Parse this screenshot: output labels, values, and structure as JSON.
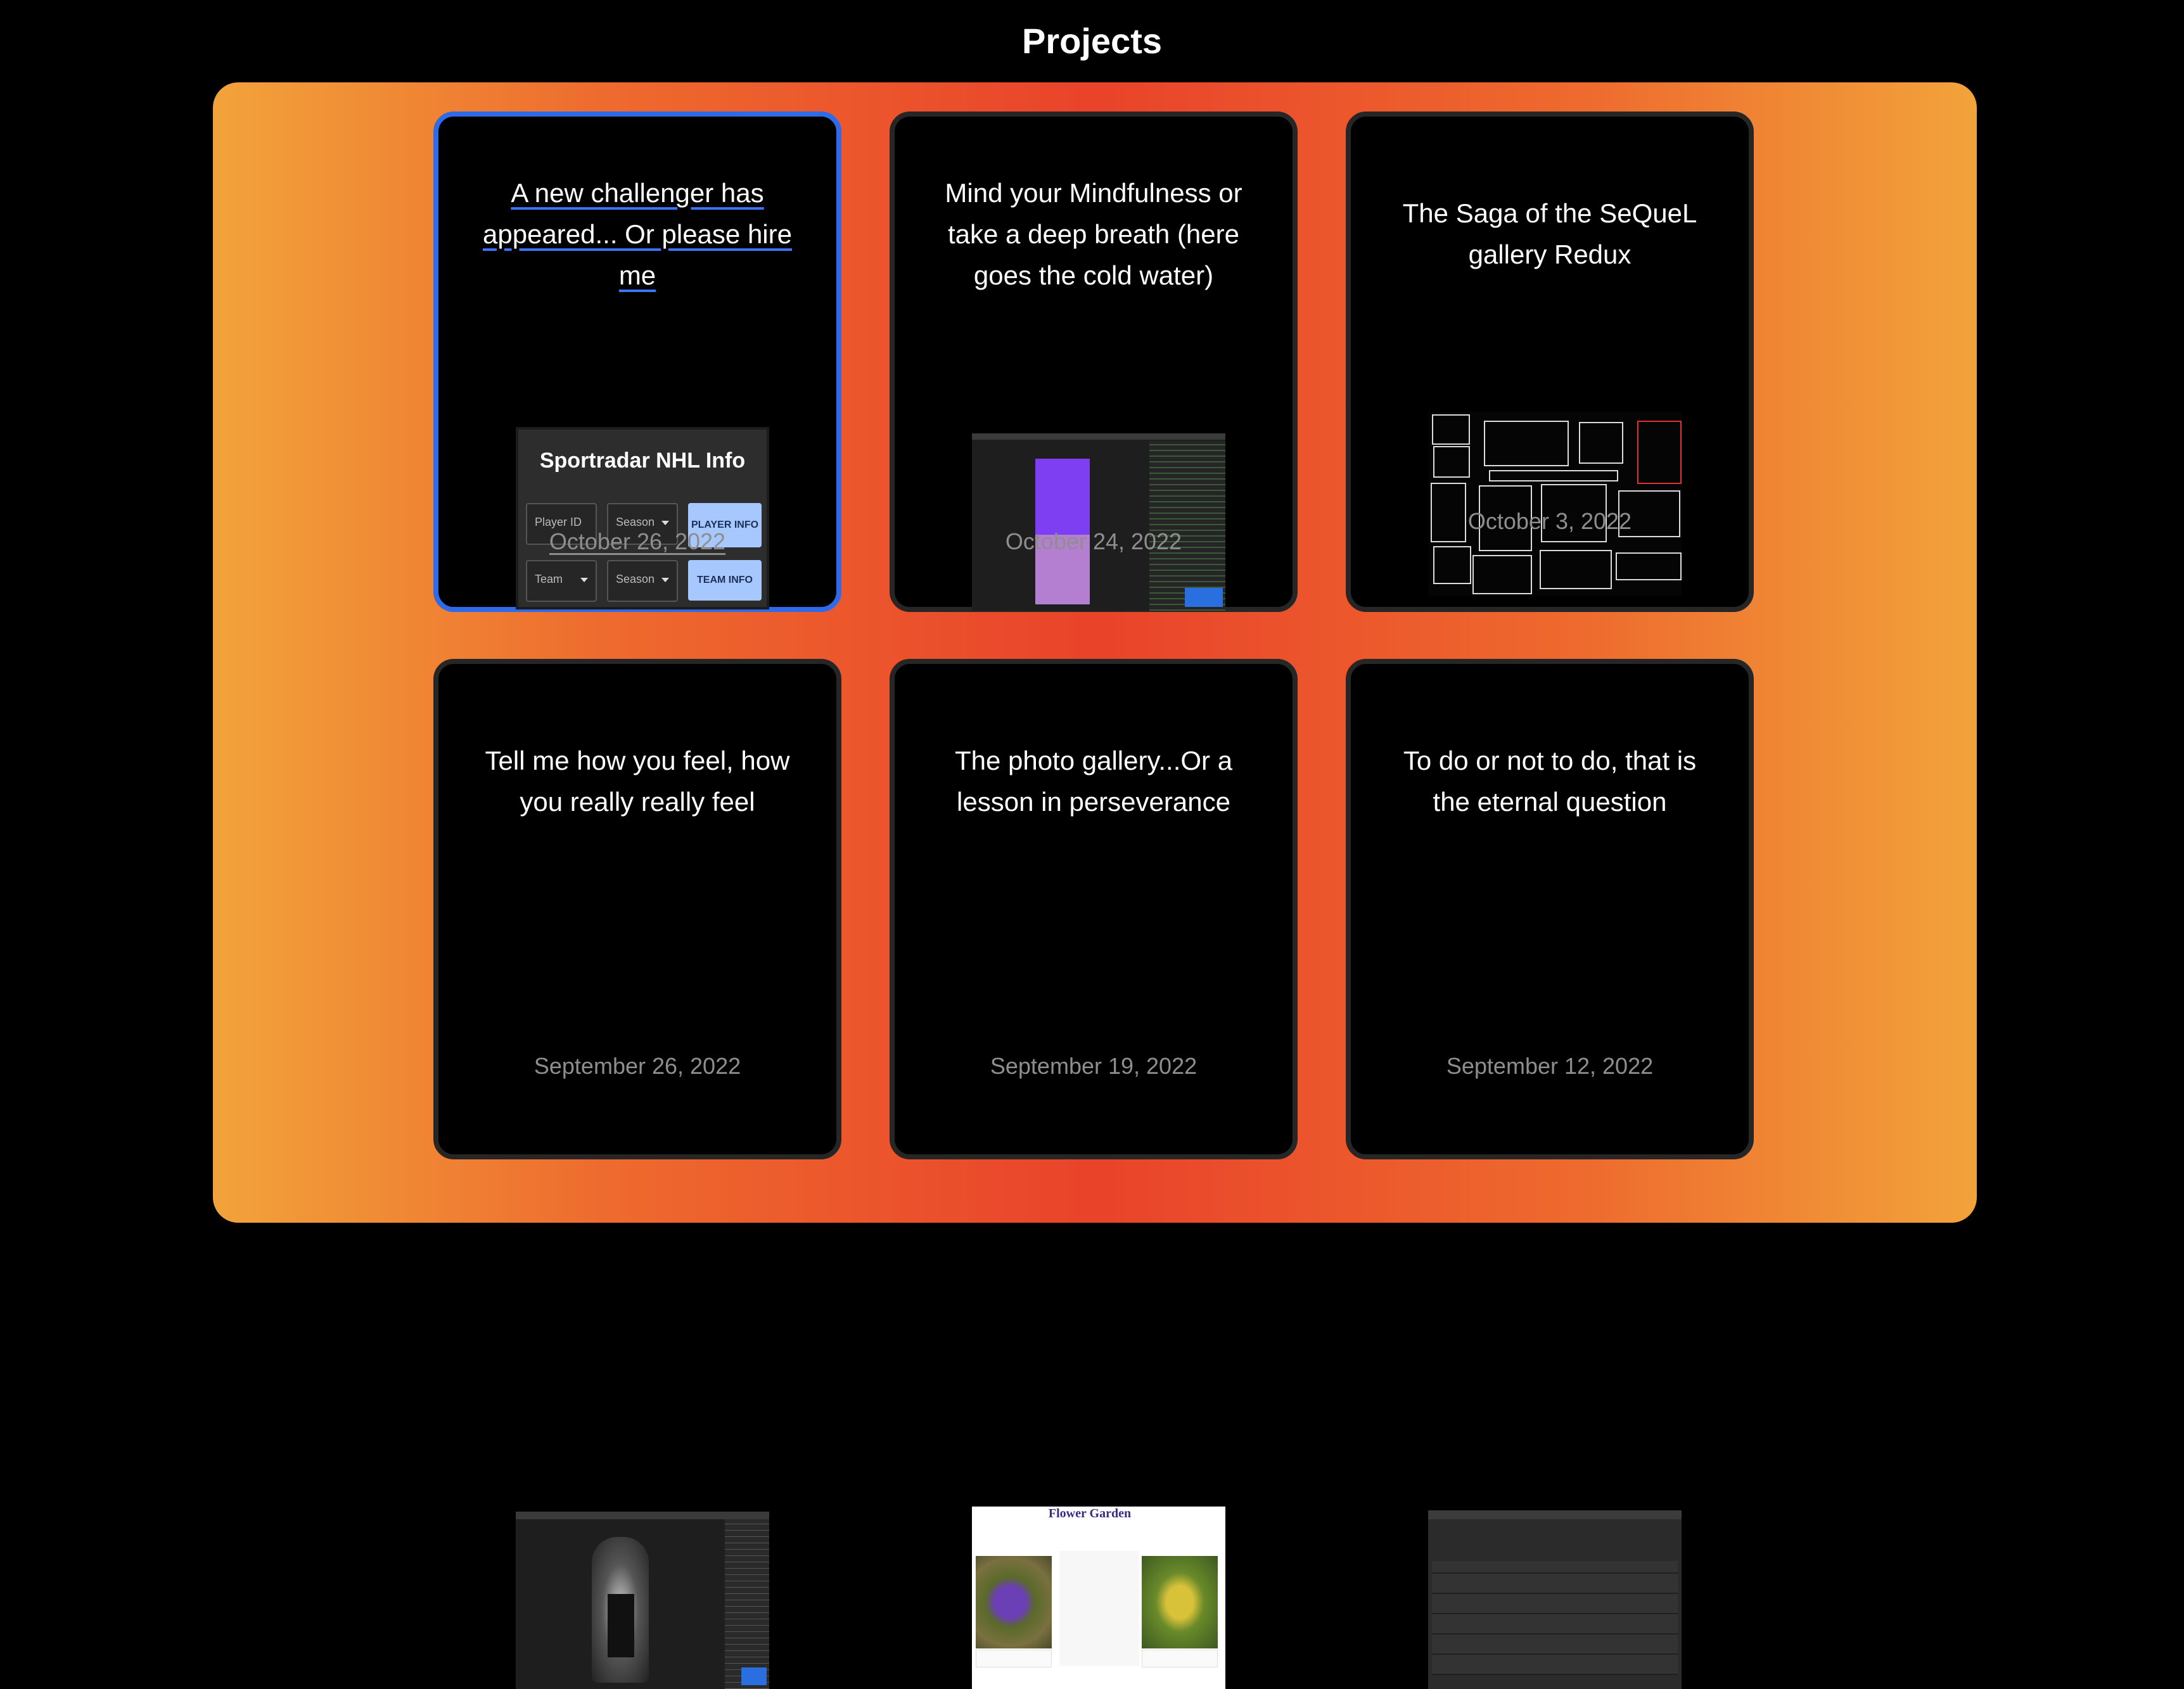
{
  "page": {
    "title": "Projects"
  },
  "colors": {
    "accent_border": "#2f6be8",
    "card_border": "#262626",
    "date_color": "#8e8e8e"
  },
  "projects": [
    {
      "title": "A new challenger has appeared... Or please hire me",
      "date": "October 26, 2022",
      "thumbnail": {
        "heading": "Sportradar NHL Info",
        "player_id_placeholder": "Player ID",
        "season_label_1": "Season",
        "player_info_button": "PLAYER INFO",
        "team_label": "Team",
        "season_label_2": "Season",
        "team_info_button": "TEAM INFO"
      }
    },
    {
      "title": "Mind your Mindfulness or take a deep breath (here goes the cold water)",
      "date": "October 24, 2022"
    },
    {
      "title": "The Saga of the SeQueL gallery Redux",
      "date": "October 3, 2022"
    },
    {
      "title": "Tell me how you feel, how you really really feel",
      "date": "September 26, 2022"
    },
    {
      "title": "The photo gallery...Or a lesson in perseverance",
      "date": "September 19, 2022",
      "thumbnail": {
        "heading": "Flower Garden"
      }
    },
    {
      "title": "To do or not to do, that is the eternal question",
      "date": "September 12, 2022"
    }
  ]
}
